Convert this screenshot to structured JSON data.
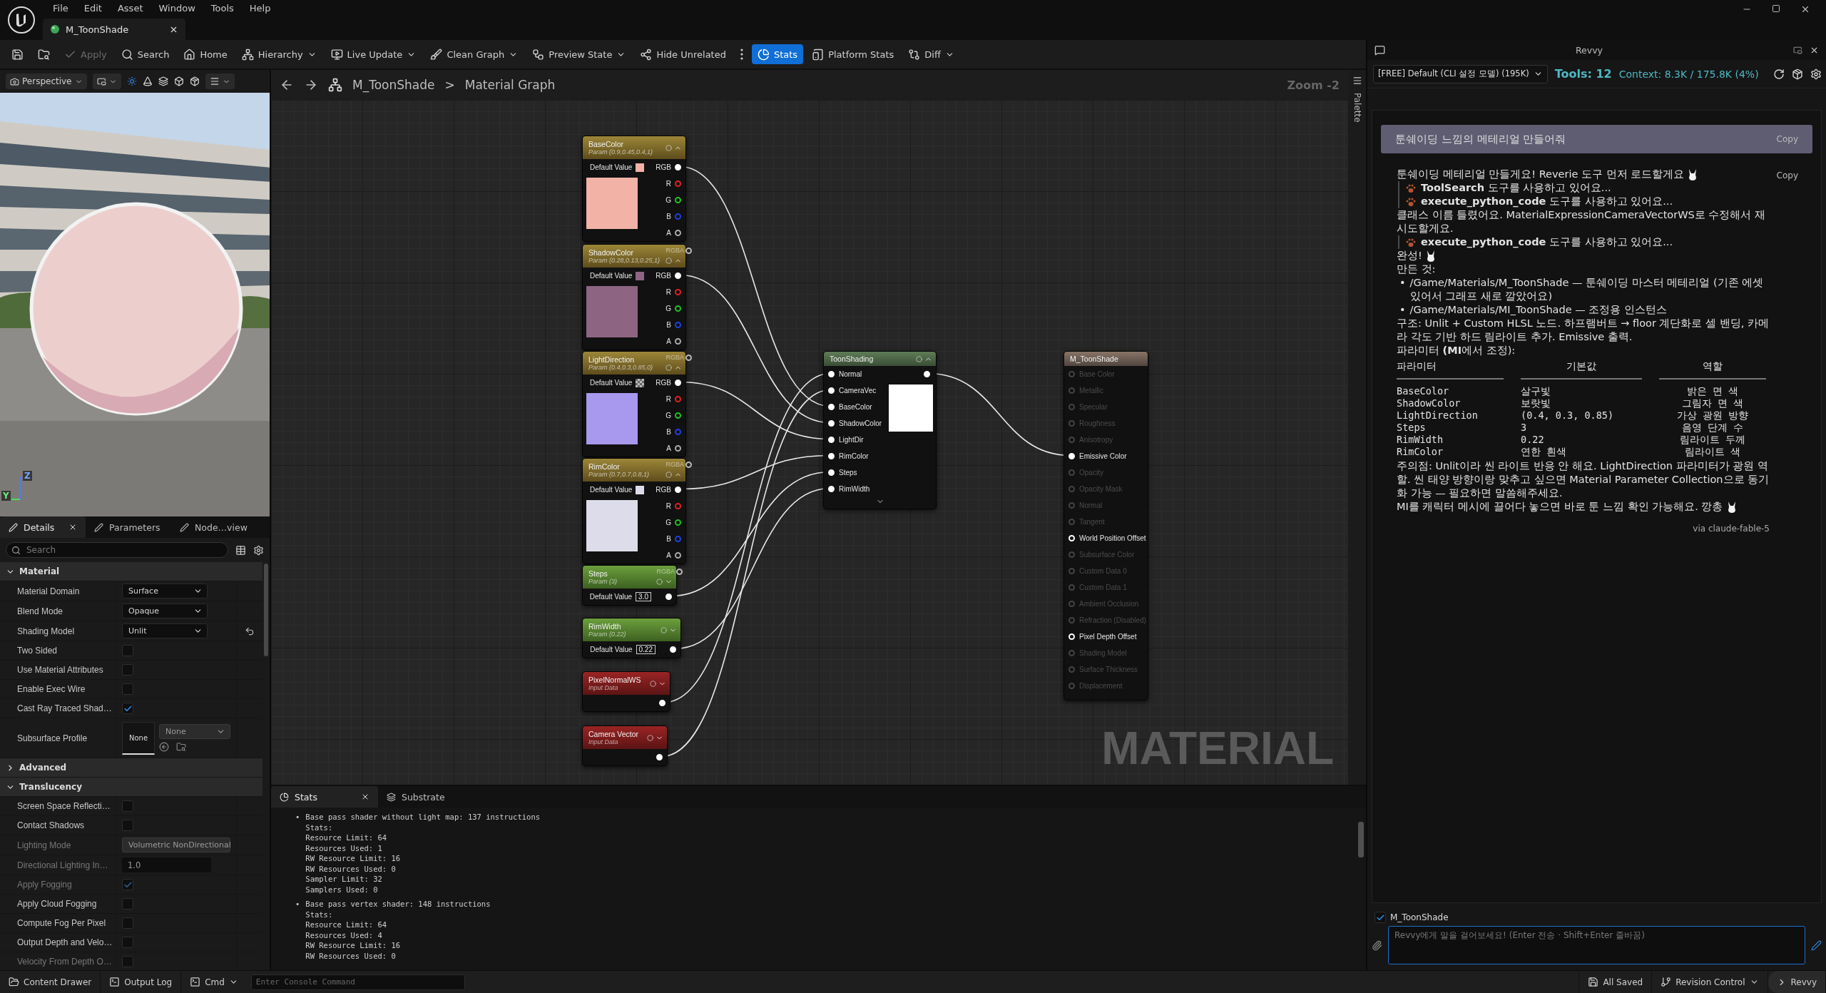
{
  "menu": [
    "File",
    "Edit",
    "Asset",
    "Window",
    "Tools",
    "Help"
  ],
  "document_tab": {
    "label": "M_ToonShade"
  },
  "toolbar": [
    {
      "dropdown": false,
      "selected": false,
      "disabled": false
    },
    {
      "dropdown": false,
      "selected": false,
      "disabled": false
    },
    {
      "label": "Apply",
      "dropdown": false,
      "selected": false,
      "disabled": true
    },
    {
      "label": "Search",
      "dropdown": false,
      "selected": false,
      "disabled": false
    },
    {
      "label": "Home",
      "dropdown": false,
      "selected": false,
      "disabled": false
    },
    {
      "label": "Hierarchy",
      "dropdown": true,
      "selected": false,
      "disabled": false
    },
    {
      "label": "Live Update",
      "dropdown": true,
      "selected": false,
      "disabled": false
    },
    {
      "label": "Clean Graph",
      "dropdown": true,
      "selected": false,
      "disabled": false
    },
    {
      "label": "Preview State",
      "dropdown": true,
      "selected": false,
      "disabled": false
    },
    {
      "label": "Hide Unrelated",
      "dropdown": false,
      "selected": false,
      "disabled": false
    },
    {
      "dropdown": false,
      "selected": false,
      "disabled": false
    },
    {
      "label": "Stats",
      "dropdown": false,
      "selected": true,
      "disabled": false
    },
    {
      "label": "Platform Stats",
      "dropdown": false,
      "selected": false,
      "disabled": false
    },
    {
      "label": "Diff",
      "dropdown": true,
      "selected": false,
      "disabled": false
    }
  ],
  "viewport": {
    "view_mode": "Perspective",
    "gizmo_labels": [
      "Z",
      "Y"
    ]
  },
  "details": {
    "tabs": [
      {
        "label": "Details",
        "selected": true
      },
      {
        "label": "Parameters",
        "selected": false
      },
      {
        "label": "Node…view",
        "selected": false
      }
    ],
    "search_placeholder": "Search",
    "sections": [
      {
        "title": "Material",
        "expanded": true,
        "rows": [
          {
            "kind": "dropdown",
            "label": "Material Domain",
            "value": "Surface",
            "disabled": false,
            "reset": false
          },
          {
            "kind": "dropdown",
            "label": "Blend Mode",
            "value": "Opaque",
            "disabled": false,
            "reset": false
          },
          {
            "kind": "dropdown",
            "label": "Shading Model",
            "value": "Unlit",
            "disabled": false,
            "reset": true
          },
          {
            "kind": "checkbox",
            "label": "Two Sided",
            "checked": false,
            "disabled": false,
            "reset": false
          },
          {
            "kind": "checkbox",
            "label": "Use Material Attributes",
            "checked": false,
            "disabled": false,
            "reset": false
          },
          {
            "kind": "checkbox",
            "label": "Enable Exec Wire",
            "checked": false,
            "disabled": false,
            "reset": false
          },
          {
            "kind": "checkbox",
            "label": "Cast Ray Traced Shad…",
            "checked": true,
            "disabled": false,
            "reset": false
          },
          {
            "kind": "asset",
            "label": "Subsurface Profile",
            "thumbnail": "None",
            "value": "None",
            "disabled": false,
            "reset": false
          }
        ]
      },
      {
        "title": "Advanced",
        "expanded": false
      },
      {
        "title": "Translucency",
        "expanded": true,
        "rows": [
          {
            "kind": "checkbox",
            "label": "Screen Space Reflecti…",
            "checked": false,
            "disabled": false,
            "reset": false
          },
          {
            "kind": "checkbox",
            "label": "Contact Shadows",
            "checked": false,
            "disabled": false,
            "reset": false
          },
          {
            "kind": "dropdown",
            "label": "Lighting Mode",
            "value": "Volumetric NonDirectional",
            "disabled": true,
            "reset": false
          },
          {
            "kind": "number",
            "label": "Directional Lighting In…",
            "value": "1.0",
            "disabled": true,
            "reset": false
          },
          {
            "kind": "checkbox",
            "label": "Apply Fogging",
            "checked": true,
            "disabled": true,
            "reset": false
          },
          {
            "kind": "checkbox",
            "label": "Apply Cloud Fogging",
            "checked": false,
            "disabled": false,
            "reset": false
          },
          {
            "kind": "checkbox",
            "label": "Compute Fog Per Pixel",
            "checked": false,
            "disabled": false,
            "reset": false
          },
          {
            "kind": "checkbox",
            "label": "Output Depth and Velo…",
            "checked": false,
            "disabled": false,
            "reset": false
          },
          {
            "kind": "checkbox",
            "label": "Velocity From Depth O…",
            "checked": false,
            "disabled": true,
            "reset": false
          }
        ]
      }
    ]
  },
  "graph": {
    "breadcrumb": [
      "M_ToonShade",
      "Material Graph"
    ],
    "separator": ">",
    "zoom": "Zoom -2",
    "watermark": "MATERIAL",
    "palette_label": "Palette",
    "param_nodes": [
      {
        "kind": "vector",
        "title": "BaseColor",
        "subtitle": "Param (0.9,0.45,0.4,1)",
        "default_label": "Default Value",
        "output_label": "RGB",
        "channels": [
          "R",
          "G",
          "B",
          "A"
        ]
      },
      {
        "kind": "vector",
        "title": "ShadowColor",
        "subtitle": "Param (0.28,0.13,0.25,1)",
        "overlap_label": "RGBA",
        "default_label": "Default Value",
        "output_label": "RGB",
        "channels": [
          "R",
          "G",
          "B",
          "A"
        ]
      },
      {
        "kind": "vector",
        "title": "LightDirection",
        "subtitle": "Param (0.4,0.3,0.85,0)",
        "overlap_label": "RGBA",
        "default_label": "Default Value",
        "output_label": "RGB",
        "channels": [
          "R",
          "G",
          "B",
          "A"
        ]
      },
      {
        "kind": "vector",
        "title": "RimColor",
        "subtitle": "Param (0.7,0.7,0.8,1)",
        "overlap_label": "RGBA",
        "default_label": "Default Value",
        "output_label": "RGB",
        "channels": [
          "R",
          "G",
          "B",
          "A"
        ]
      },
      {
        "kind": "scalar",
        "title": "Steps",
        "subtitle": "Param (3)",
        "overlap_label": "RGBA",
        "default_label": "Default Value",
        "value": "3.0"
      },
      {
        "kind": "scalar",
        "title": "RimWidth",
        "subtitle": "Param (0.22)",
        "default_label": "Default Value",
        "value": "0.22"
      },
      {
        "kind": "input",
        "title": "PixelNormalWS",
        "subtitle": "Input Data"
      },
      {
        "kind": "input",
        "title": "Camera Vector",
        "subtitle": "Input Data"
      }
    ],
    "toon_node": {
      "title": "ToonShading",
      "inputs": [
        "Normal",
        "CameraVec",
        "BaseColor",
        "ShadowColor",
        "LightDir",
        "RimColor",
        "Steps",
        "RimWidth"
      ]
    },
    "result_node": {
      "title": "M_ToonShade",
      "pins": [
        {
          "label": "Base Color",
          "enabled": false,
          "connected": false
        },
        {
          "label": "Metallic",
          "enabled": false,
          "connected": false
        },
        {
          "label": "Specular",
          "enabled": false,
          "connected": false
        },
        {
          "label": "Roughness",
          "enabled": false,
          "connected": false
        },
        {
          "label": "Anisotropy",
          "enabled": false,
          "connected": false
        },
        {
          "label": "Emissive Color",
          "enabled": true,
          "connected": true
        },
        {
          "label": "Opacity",
          "enabled": false,
          "connected": false
        },
        {
          "label": "Opacity Mask",
          "enabled": false,
          "connected": false
        },
        {
          "label": "Normal",
          "enabled": false,
          "connected": false
        },
        {
          "label": "Tangent",
          "enabled": false,
          "connected": false
        },
        {
          "label": "World Position Offset",
          "enabled": true,
          "connected": false
        },
        {
          "label": "Subsurface Color",
          "enabled": false,
          "connected": false
        },
        {
          "label": "Custom Data 0",
          "enabled": false,
          "connected": false
        },
        {
          "label": "Custom Data 1",
          "enabled": false,
          "connected": false
        },
        {
          "label": "Ambient Occlusion",
          "enabled": false,
          "connected": false
        },
        {
          "label": "Refraction (Disabled)",
          "enabled": false,
          "connected": false
        },
        {
          "label": "Pixel Depth Offset",
          "enabled": true,
          "connected": false
        },
        {
          "label": "Shading Model",
          "enabled": false,
          "connected": false
        },
        {
          "label": "Surface Thickness",
          "enabled": false,
          "connected": false
        },
        {
          "label": "Displacement",
          "enabled": false,
          "connected": false
        }
      ]
    }
  },
  "stats": {
    "tabs": [
      {
        "label": "Stats",
        "selected": true
      },
      {
        "label": "Substrate",
        "selected": false
      }
    ],
    "entries": [
      {
        "bullet": "•",
        "title": "Base pass shader without light map: 137 instructions",
        "lines": [
          "Stats:",
          "Resource Limit: 64",
          "Resources Used: 1",
          "RW Resource Limit: 16",
          "RW Resources Used: 0",
          "Sampler Limit: 32",
          "Samplers Used: 0"
        ]
      },
      {
        "bullet": "•",
        "title": "Base pass vertex shader: 148 instructions",
        "lines": [
          "Stats:",
          "Resource Limit: 64",
          "Resources Used: 4",
          "RW Resource Limit: 16",
          "RW Resources Used: 0"
        ]
      }
    ]
  },
  "chat": {
    "title": "Revvy",
    "model": "[FREE] Default (CLI 설정 모델) (195K)",
    "tools": "Tools: 12",
    "context": "Context: 8.3K / 175.8K (4%)",
    "user_message": {
      "text": "툰쉐이딩 느낌의 메테리얼 만들어줘",
      "copy": "Copy"
    },
    "reply_copy": "Copy",
    "blocks": [
      {
        "kind": "text",
        "text": "툰쉐이딩 메테리얼 만들게요! Reverie 도구 먼저 로드할게요",
        "rabbit": true
      },
      {
        "kind": "tool",
        "text": "**ToolSearch** 도구를 사용하고 있어요...",
        "rabbit": false
      },
      {
        "kind": "tool",
        "text": "**execute_python_code** 도구를 사용하고 있어요...",
        "rabbit": false
      },
      {
        "kind": "text",
        "text": "클래스 이름 틀렸어요. MaterialExpressionCameraVectorWS로 수정해서 재시도할게요.",
        "rabbit": false
      },
      {
        "kind": "tool",
        "text": "**execute_python_code** 도구를 사용하고 있어요...",
        "rabbit": false
      },
      {
        "kind": "text",
        "text": "완성!",
        "rabbit": true
      },
      {
        "kind": "text",
        "text": "만든 것:",
        "rabbit": false
      },
      {
        "kind": "bullet",
        "bullet": "•",
        "text": "/Game/Materials/M_ToonShade — 툰쉐이딩 마스터 메테리얼 (기존 에셋 있어서 그래프 새로 깔았어요)",
        "rabbit": false
      },
      {
        "kind": "bullet",
        "bullet": "•",
        "text": "/Game/Materials/MI_ToonShade — 조정용 인스턴스",
        "rabbit": false
      },
      {
        "kind": "text",
        "text": "구조: Unlit + Custom HLSL 노드. 하프램버트 → floor 계단화로 셀 밴딩, 카메라 각도 기반 하드 림라이트 추가. Emissive 출력.",
        "rabbit": false
      },
      {
        "kind": "text",
        "text": "파라미터 **(MI**에서 조정):",
        "rabbit": false
      },
      {
        "kind": "table",
        "columns": [
          "파라미터",
          "기본값",
          "역할"
        ],
        "rows": [
          [
            "BaseColor",
            "살구빛",
            "밝은 면 색"
          ],
          [
            "ShadowColor",
            "보랏빛",
            "그림자 면 색"
          ],
          [
            "LightDirection",
            "(0.4, 0.3, 0.85)",
            "가상 광원 방향"
          ],
          [
            "Steps",
            "3",
            "음영 단계 수"
          ],
          [
            "RimWidth",
            "0.22",
            "림라이트 두께"
          ],
          [
            "RimColor",
            "연한 흰색",
            "림라이트 색"
          ]
        ]
      },
      {
        "kind": "text",
        "text": "주의점: Unlit이라 씬 라이트 반응 안 해요. LightDirection 파라미터가 광원 역할. 씬 태양 방향이랑 맞추고 싶으면 Material Parameter Collection으로 동기화 가능 — 필요하면 말씀해주세요.",
        "rabbit": false
      },
      {
        "kind": "text",
        "text": "MI를 캐릭터 메시에 끌어다 놓으면 바로 툰 느낌 확인 가능해요. 깡총",
        "rabbit": true
      }
    ],
    "via": "via claude-fable-5",
    "context_item": {
      "label": "M_ToonShade",
      "checked": true
    },
    "input_placeholder": "Revvy에게 말을 걸어보세요! (Enter 전송 · Shift+Enter 줄바꿈)"
  },
  "status_bar": {
    "content_drawer": "Content Drawer",
    "output_log": "Output Log",
    "cmd": "Cmd",
    "console_placeholder": "Enter Console Command",
    "saved": "All Saved",
    "revision": "Revision Control",
    "revvy": "Revvy"
  }
}
